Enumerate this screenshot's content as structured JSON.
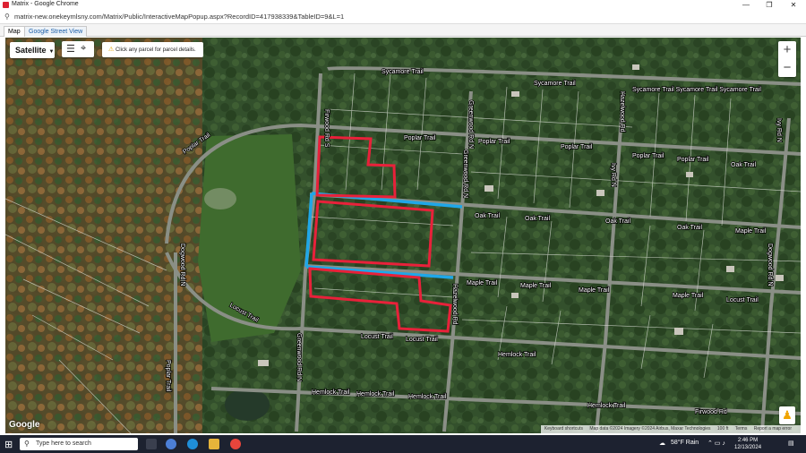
{
  "window": {
    "title": "Matrix - Google Chrome",
    "minimize": "—",
    "maximize": "❐",
    "close": "✕"
  },
  "address_bar": {
    "url": "matrix-new.onekeymlsny.com/Matrix/Public/InteractiveMapPopup.aspx?RecordID=417938339&TableID=9&L=1"
  },
  "tabs": [
    {
      "label": "Map"
    },
    {
      "label": "Google Street View"
    }
  ],
  "map": {
    "type_button": "Satellite",
    "hint": "Click any parcel for parcel details.",
    "zoom_in": "+",
    "zoom_out": "−",
    "logo": "Google",
    "attribution": {
      "shortcuts": "Keyboard shortcuts",
      "data": "Map data ©2024 Imagery ©2024 Airbus, Maxar Technologies",
      "scale": "100 ft",
      "terms": "Terms",
      "report": "Report a map error"
    },
    "streets": [
      "Sycamore Trail",
      "Sycamore Trail",
      "Sycamore Trail Sycamore Trail Sycamore Trail",
      "Poplar Trail",
      "Poplar Trail",
      "Poplar Trail",
      "Poplar Trail",
      "Poplar Trail",
      "Poplar Trail",
      "Oak Trail",
      "Oak Trail",
      "Oak Trail",
      "Oak Trail",
      "Oak Trail",
      "Maple Trail",
      "Maple Trail",
      "Maple Trail",
      "Maple Trail",
      "Maple Trail",
      "Locust Trail",
      "Locust Trail",
      "Locust Trail",
      "Locust Trail",
      "Hemlock Trail",
      "Hemlock Trail",
      "Hemlock Trail",
      "Hemlock Trail",
      "Hemlock Trail",
      "Firwood Rd",
      "Firwood Rd S",
      "Greenwood Rd N",
      "Greenwood Rd N",
      "Greenwood Rd N",
      "Hazelwood Rd",
      "Hazelwood Rd",
      "Ivy Rd N",
      "Ivy Rd N",
      "Dogwood Rd N",
      "Dogwood Rd N",
      "Poplar Trail"
    ]
  },
  "taskbar": {
    "search_placeholder": "Type here to search",
    "weather": "58°F  Rain",
    "time": "2:46 PM",
    "date": "12/13/2024"
  },
  "colors": {
    "parcel_outline": "#e8213a",
    "road_highlight": "#1fa7e8",
    "map_bg": "#2f4d2a",
    "taskbar": "#1d2230"
  },
  "icons": {
    "layers": "layers-icon",
    "location": "location-icon",
    "warning": "warning-icon",
    "pegman": "pegman-icon"
  }
}
